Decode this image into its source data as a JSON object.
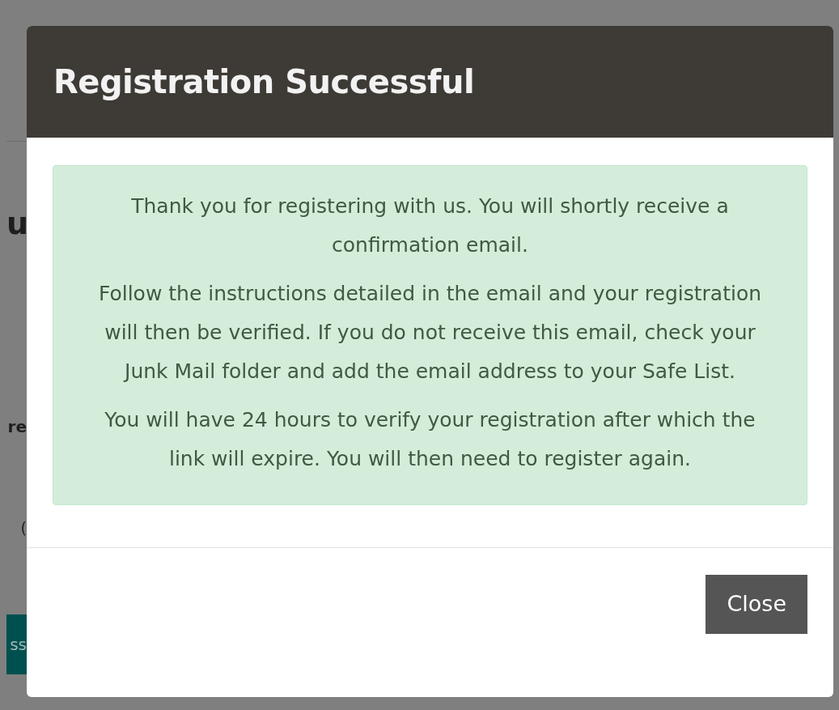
{
  "background_fragments": [
    {
      "kind": "heading",
      "text": "u"
    },
    {
      "kind": "label",
      "text": "re"
    },
    {
      "kind": "note",
      "text": "("
    },
    {
      "kind": "button",
      "text": "ss"
    }
  ],
  "modal": {
    "title": "Registration Successful",
    "alert": {
      "paragraphs": [
        "Thank you for registering with us. You will shortly receive a confirmation email.",
        "Follow the instructions detailed in the email and your registration will then be verified. If you do not receive this email, check your Junk Mail folder and add the email address to your Safe List.",
        "You will have 24 hours to verify your registration after which the link will expire. You will then need to register again."
      ]
    },
    "buttons": [
      "Close"
    ]
  }
}
